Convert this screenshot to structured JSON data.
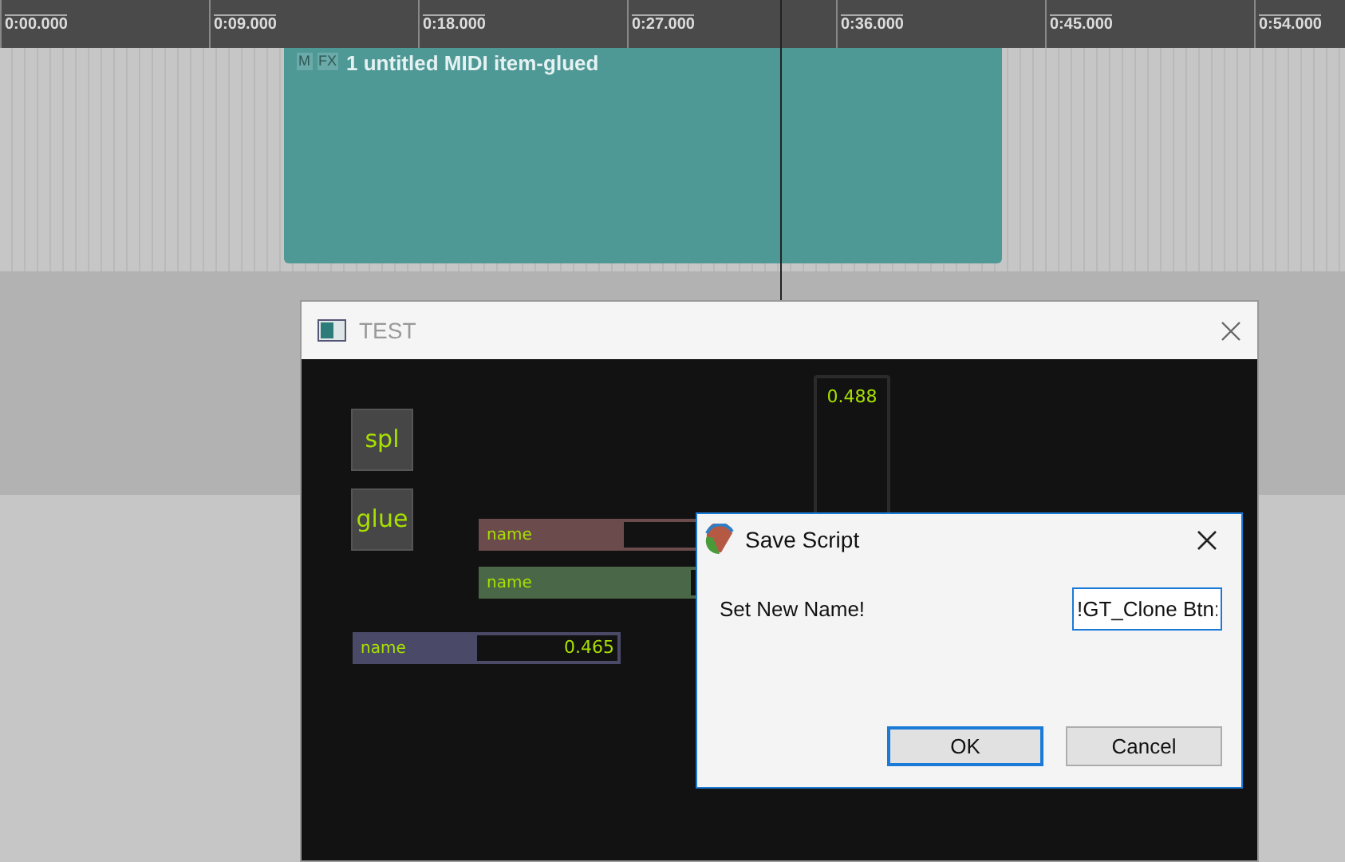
{
  "ruler": {
    "times": [
      "0:00.000",
      "0:09.000",
      "0:18.000",
      "0:27.000",
      "0:36.000",
      "0:45.000",
      "0:54.000"
    ]
  },
  "item": {
    "badges": [
      "M",
      "FX"
    ],
    "title": "1 untitled MIDI item-glued"
  },
  "script_window": {
    "title": "TEST",
    "buttons": [
      "spl",
      "glue"
    ],
    "sliders": [
      {
        "label": "name",
        "level": 0.54,
        "color": "#6b4b4b"
      },
      {
        "label": "name",
        "level": 0.8,
        "color": "#4a6848"
      },
      {
        "label": "name",
        "level": 0.465,
        "color": "#4a4a68",
        "reading": "0.465"
      }
    ],
    "vertical_slider": {
      "reading": "0.488"
    }
  },
  "dialog": {
    "title": "Save Script",
    "prompt": "Set New Name!",
    "value": "!GT_Clone Btn:",
    "buttons": [
      {
        "label": "OK",
        "selected": true
      },
      {
        "label": "Cancel",
        "selected": false
      }
    ]
  }
}
